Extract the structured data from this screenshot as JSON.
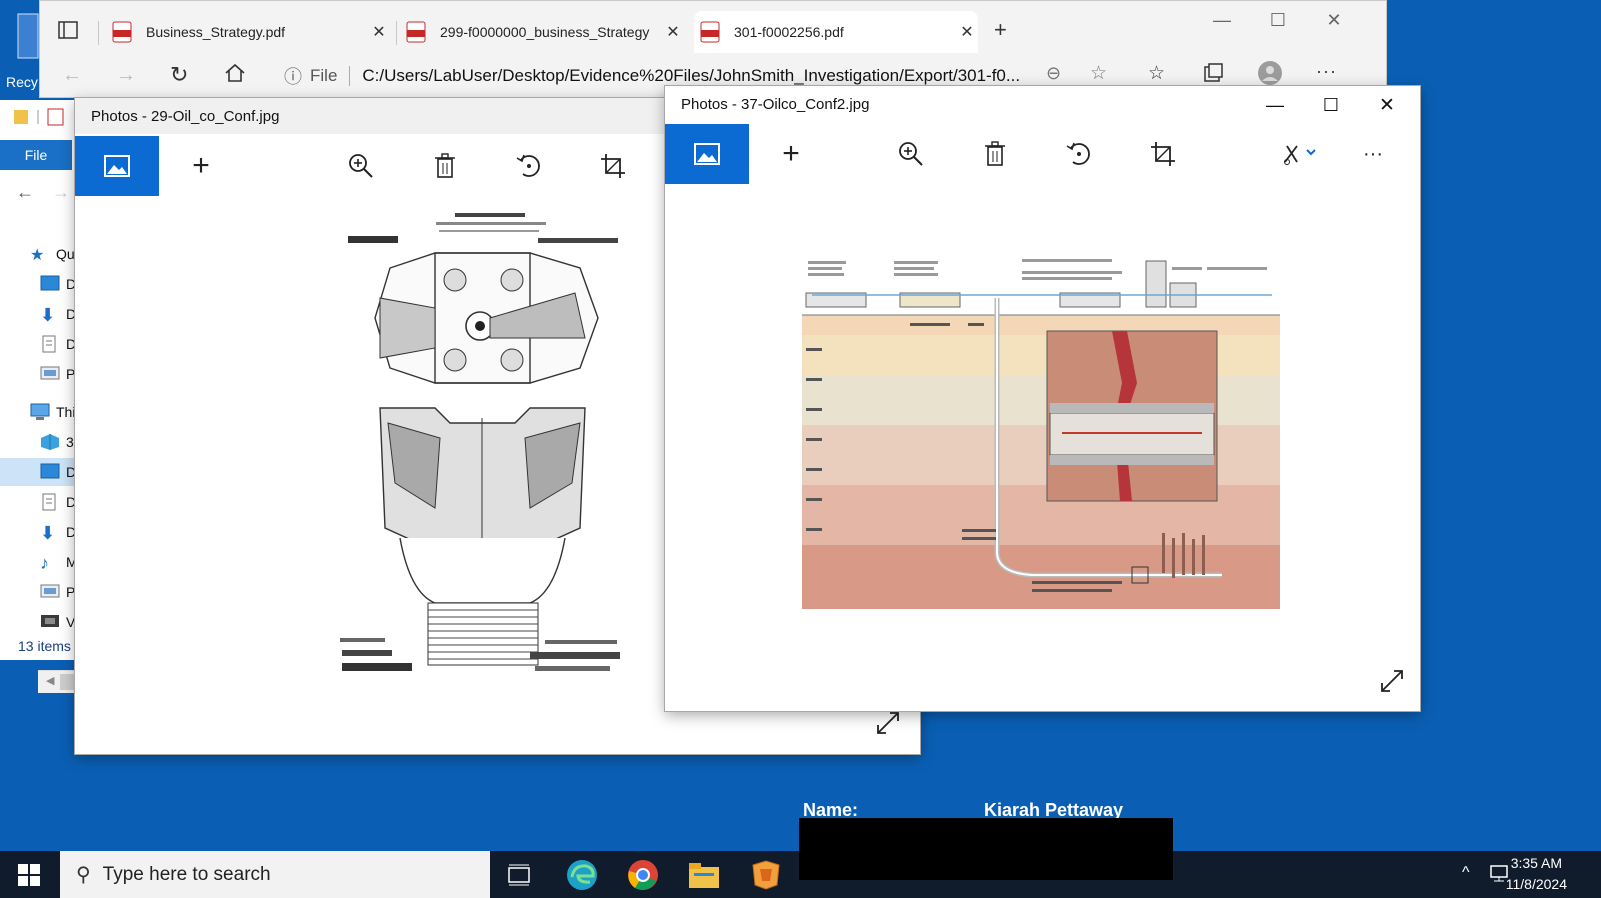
{
  "desktop": {
    "icon_label": "Recy",
    "name_label": "Name:",
    "name_value": "Kiarah Pettaway"
  },
  "browser": {
    "tabs": [
      {
        "title": "Business_Strategy.pdf"
      },
      {
        "title": "299-f0000000_business_Strategy"
      },
      {
        "title": "301-f0002256.pdf"
      }
    ],
    "file_label": "File",
    "url": "C:/Users/LabUser/Desktop/Evidence%20Files/JohnSmith_Investigation/Export/301-f0..."
  },
  "explorer": {
    "file_tab": "File",
    "nav": [
      {
        "label": "Qu",
        "icon": "star-icon"
      },
      {
        "label": "D",
        "icon": "desktop-icon"
      },
      {
        "label": "D",
        "icon": "download-icon"
      },
      {
        "label": "D",
        "icon": "document-icon"
      },
      {
        "label": "P",
        "icon": "pictures-icon"
      },
      {
        "label": "Thi",
        "icon": "this-pc-icon"
      },
      {
        "label": "3",
        "icon": "3d-objects-icon"
      },
      {
        "label": "D",
        "icon": "desktop-icon"
      },
      {
        "label": "D",
        "icon": "document-icon"
      },
      {
        "label": "D",
        "icon": "download-icon"
      },
      {
        "label": "M",
        "icon": "music-icon"
      },
      {
        "label": "P",
        "icon": "pictures-icon"
      },
      {
        "label": "V",
        "icon": "video-icon"
      }
    ],
    "status": "13 items"
  },
  "photos_back": {
    "title": "Photos - 29-Oil_co_Conf.jpg"
  },
  "photos_front": {
    "title": "Photos - 37-Oilco_Conf2.jpg"
  },
  "taskbar": {
    "search_placeholder": "Type here to search",
    "time": "3:35 AM",
    "date": "11/8/2024"
  },
  "colors": {
    "desktop": "#0a5fb4",
    "accent": "#0b6bd3",
    "taskbar": "#101c2b"
  }
}
